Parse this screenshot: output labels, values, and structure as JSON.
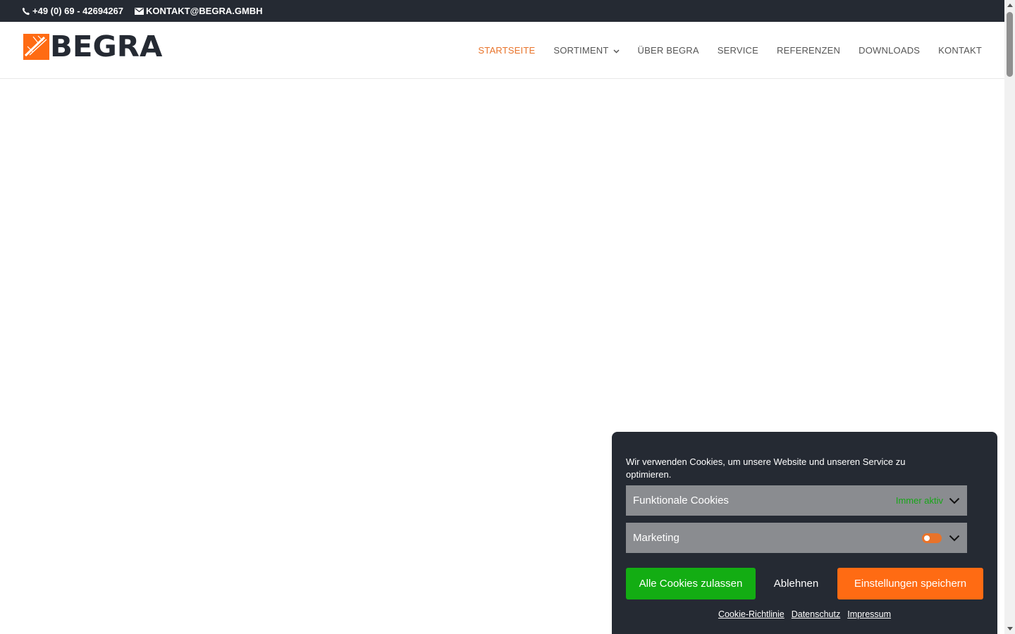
{
  "topbar": {
    "phone": "+49 (0) 69 - 42694267",
    "email": "KONTAKT@BEGRA.GMBH"
  },
  "logo": {
    "text": "BEGRA"
  },
  "nav": {
    "items": [
      {
        "label": "STARTSEITE",
        "active": true
      },
      {
        "label": "SORTIMENT",
        "has_dropdown": true
      },
      {
        "label": "ÜBER BEGRA"
      },
      {
        "label": "SERVICE"
      },
      {
        "label": "REFERENZEN"
      },
      {
        "label": "DOWNLOADS"
      },
      {
        "label": "KONTAKT"
      }
    ]
  },
  "cookie": {
    "message": "Wir verwenden Cookies, um unsere Website und unseren Service zu optimieren.",
    "categories": [
      {
        "label": "Funktionale Cookies",
        "status": "Immer aktiv"
      },
      {
        "label": "Marketing",
        "enabled": false
      }
    ],
    "buttons": {
      "accept": "Alle Cookies zulassen",
      "deny": "Ablehnen",
      "save": "Einstellungen speichern"
    },
    "links": [
      "Cookie-Richtlinie",
      "Datenschutz",
      "Impressum"
    ]
  },
  "colors": {
    "dark": "#252a33",
    "accent": "#e8732a",
    "accept_green": "#13ad13",
    "save_orange": "#ff6b13",
    "category_bg": "#8a8c90",
    "always_active_green": "#17a617"
  }
}
